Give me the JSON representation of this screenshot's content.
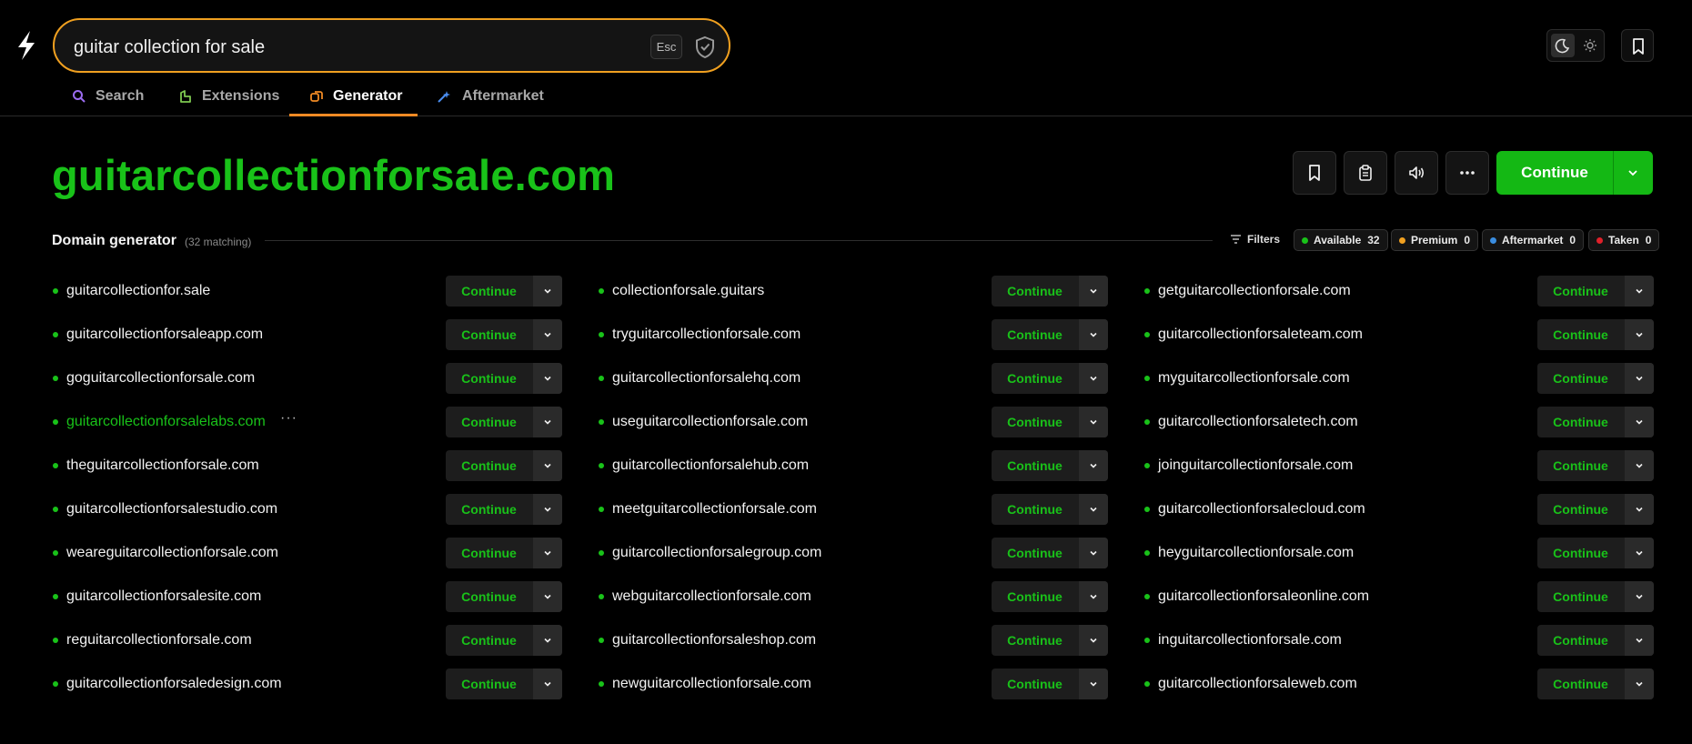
{
  "search": {
    "query": "guitar collection for sale",
    "esc_label": "Esc"
  },
  "tabs": [
    {
      "label": "Search",
      "icon": "search-icon",
      "color": "#9b6cf0"
    },
    {
      "label": "Extensions",
      "icon": "extensions-icon",
      "color": "#7ec850"
    },
    {
      "label": "Generator",
      "icon": "generator-icon",
      "color": "#f08a24",
      "active": true
    },
    {
      "label": "Aftermarket",
      "icon": "aftermarket-icon",
      "color": "#4a8df0"
    }
  ],
  "hero": {
    "domain": "guitarcollectionforsale.com",
    "continue_label": "Continue"
  },
  "generator": {
    "title": "Domain generator",
    "count": "(32 matching)",
    "filters_label": "Filters",
    "chips": [
      {
        "label": "Available",
        "count": "32",
        "color": "#19c219"
      },
      {
        "label": "Premium",
        "count": "0",
        "color": "#f0a020"
      },
      {
        "label": "Aftermarket",
        "count": "0",
        "color": "#3a8de0"
      },
      {
        "label": "Taken",
        "count": "0",
        "color": "#e0202a"
      }
    ],
    "continue_label": "Continue",
    "more_label": "···",
    "columns": [
      [
        "guitarcollectionfor.sale",
        "guitarcollectionforsaleapp.com",
        "goguitarcollectionforsale.com",
        "guitarcollectionforsalelabs.com",
        "theguitarcollectionforsale.com",
        "guitarcollectionforsalestudio.com",
        "weareguitarcollectionforsale.com",
        "guitarcollectionforsalesite.com",
        "reguitarcollectionforsale.com",
        "guitarcollectionforsaledesign.com"
      ],
      [
        "collectionforsale.guitars",
        "tryguitarcollectionforsale.com",
        "guitarcollectionforsalehq.com",
        "useguitarcollectionforsale.com",
        "guitarcollectionforsalehub.com",
        "meetguitarcollectionforsale.com",
        "guitarcollectionforsalegroup.com",
        "webguitarcollectionforsale.com",
        "guitarcollectionforsaleshop.com",
        "newguitarcollectionforsale.com"
      ],
      [
        "getguitarcollectionforsale.com",
        "guitarcollectionforsaleteam.com",
        "myguitarcollectionforsale.com",
        "guitarcollectionforsaletech.com",
        "joinguitarcollectionforsale.com",
        "guitarcollectionforsalecloud.com",
        "heyguitarcollectionforsale.com",
        "guitarcollectionforsaleonline.com",
        "inguitarcollectionforsale.com",
        "guitarcollectionforsaleweb.com"
      ]
    ],
    "hovered_row": "guitarcollectionforsalelabs.com"
  }
}
